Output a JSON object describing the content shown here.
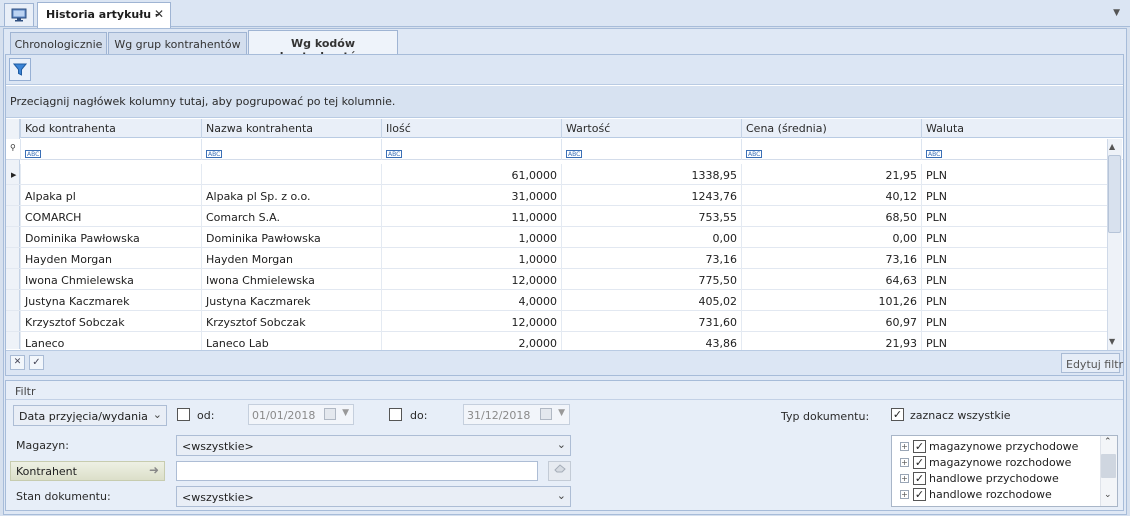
{
  "window": {
    "tab_title": "Historia artykułu - ...",
    "close_glyph": "✕",
    "menu_glyph": "▼"
  },
  "tabs": [
    {
      "label": "Chronologicznie",
      "active": false
    },
    {
      "label": "Wg grup kontrahentów",
      "active": false
    },
    {
      "label": "Wg kodów kontrahentów",
      "active": true
    }
  ],
  "grid": {
    "group_hint": "Przeciągnij nagłówek kolumny tutaj, aby pogrupować po tej kolumnie.",
    "columns": [
      "Kod kontrahenta",
      "Nazwa kontrahenta",
      "Ilość",
      "Wartość",
      "Cena (średnia)",
      "Waluta"
    ],
    "filter_icon_text": "ABC",
    "rows": [
      {
        "kod": "",
        "nazwa": "",
        "ilosc": "61,0000",
        "wartosc": "1338,95",
        "cena": "21,95",
        "waluta": "PLN"
      },
      {
        "kod": "Alpaka pl",
        "nazwa": "Alpaka pl Sp. z o.o.",
        "ilosc": "31,0000",
        "wartosc": "1243,76",
        "cena": "40,12",
        "waluta": "PLN"
      },
      {
        "kod": "COMARCH",
        "nazwa": "Comarch S.A.",
        "ilosc": "11,0000",
        "wartosc": "753,55",
        "cena": "68,50",
        "waluta": "PLN"
      },
      {
        "kod": "Dominika Pawłowska",
        "nazwa": "Dominika Pawłowska",
        "ilosc": "1,0000",
        "wartosc": "0,00",
        "cena": "0,00",
        "waluta": "PLN"
      },
      {
        "kod": "Hayden Morgan",
        "nazwa": "Hayden Morgan",
        "ilosc": "1,0000",
        "wartosc": "73,16",
        "cena": "73,16",
        "waluta": "PLN"
      },
      {
        "kod": "Iwona Chmielewska",
        "nazwa": "Iwona Chmielewska",
        "ilosc": "12,0000",
        "wartosc": "775,50",
        "cena": "64,63",
        "waluta": "PLN"
      },
      {
        "kod": "Justyna Kaczmarek",
        "nazwa": "Justyna Kaczmarek",
        "ilosc": "4,0000",
        "wartosc": "405,02",
        "cena": "101,26",
        "waluta": "PLN"
      },
      {
        "kod": "Krzysztof Sobczak",
        "nazwa": "Krzysztof Sobczak",
        "ilosc": "12,0000",
        "wartosc": "731,60",
        "cena": "60,97",
        "waluta": "PLN"
      },
      {
        "kod": "Laneco",
        "nazwa": "Laneco Lab",
        "ilosc": "2,0000",
        "wartosc": "43,86",
        "cena": "21,93",
        "waluta": "PLN"
      }
    ],
    "edit_filter_label": "Edytuj filtr"
  },
  "filter": {
    "title": "Filtr",
    "date_type": "Data przyjęcia/wydania",
    "from_label": "od:",
    "from_value": "01/01/2018",
    "from_checked": false,
    "to_label": "do:",
    "to_value": "31/12/2018",
    "to_checked": false,
    "magazyn_label": "Magazyn:",
    "magazyn_value": "<wszystkie>",
    "kontrahent_label": "Kontrahent",
    "kontrahent_value": "",
    "stan_label": "Stan dokumentu:",
    "stan_value": "<wszystkie>",
    "typ_label": "Typ dokumentu:",
    "select_all_label": "zaznacz wszystkie",
    "select_all_checked": true,
    "doc_types": [
      {
        "label": "magazynowe przychodowe",
        "checked": true
      },
      {
        "label": "magazynowe rozchodowe",
        "checked": true
      },
      {
        "label": "handlowe przychodowe",
        "checked": true
      },
      {
        "label": "handlowe rozchodowe",
        "checked": true
      }
    ]
  },
  "icons": {
    "home": "monitor-icon",
    "filter": "funnel-icon",
    "checkmark": "✓",
    "dropdown": "⌄",
    "arrow_right": "➜",
    "eraser": "eraser-icon"
  }
}
